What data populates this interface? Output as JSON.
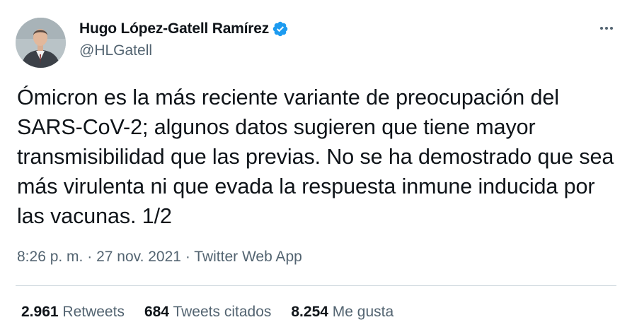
{
  "author": {
    "display_name": "Hugo López-Gatell Ramírez",
    "handle": "@HLGatell",
    "verified": true
  },
  "tweet": {
    "text": "Ómicron es la más reciente variante de preocupación del SARS-CoV-2; algunos datos sugieren que tiene mayor transmisibilidad que las previas. No se ha demostrado que sea más virulenta ni que evada la respuesta inmune inducida por las vacunas. 1/2",
    "time": "8:26 p. m.",
    "separator": "·",
    "date": "27 nov. 2021",
    "source": "Twitter Web App"
  },
  "stats": {
    "retweets_count": "2.961",
    "retweets_label": "Retweets",
    "quotes_count": "684",
    "quotes_label": "Tweets citados",
    "likes_count": "8.254",
    "likes_label": "Me gusta"
  },
  "colors": {
    "accent": "#1d9bf0",
    "text_primary": "#0f1419",
    "text_secondary": "#536471",
    "divider": "#cfd9de"
  },
  "icons": {
    "verified": "verified-badge-icon",
    "more": "more-options-icon"
  }
}
